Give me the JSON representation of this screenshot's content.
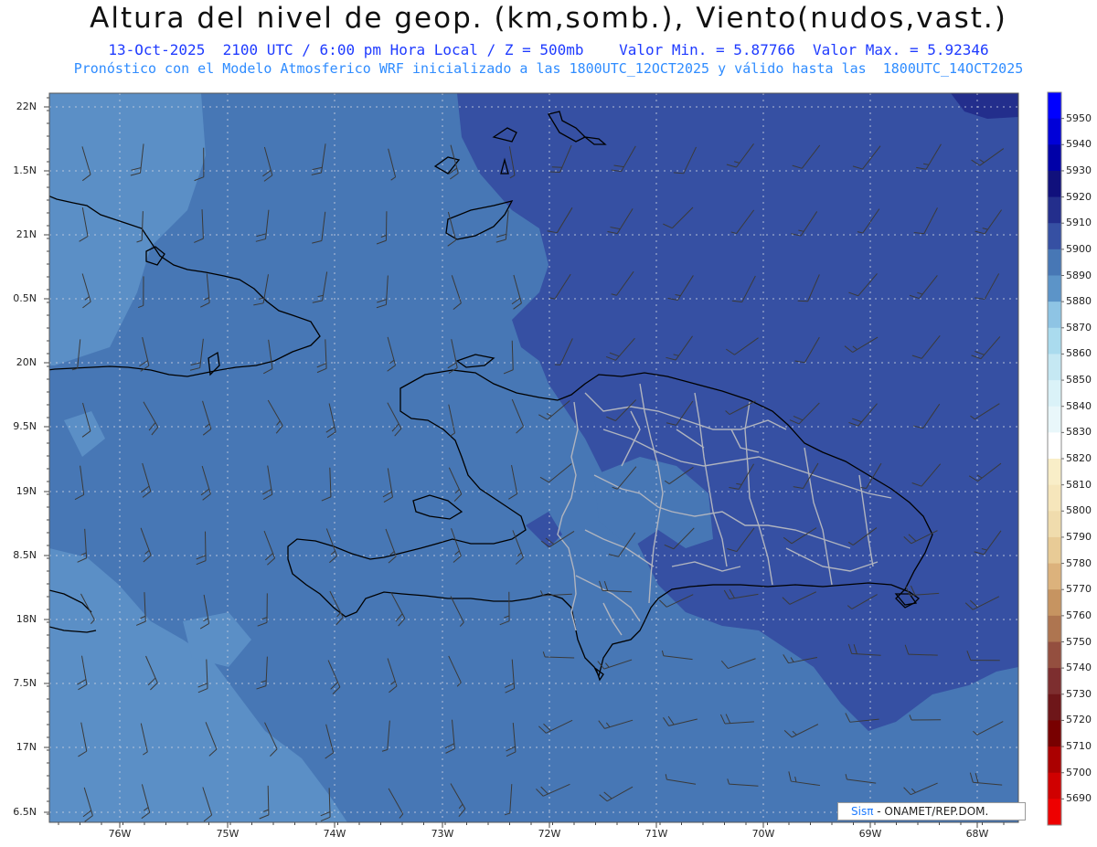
{
  "header": {
    "title": "Altura del nivel de geop. (km,somb.), Viento(nudos,vast.)",
    "subtitle": "13-Oct-2025  2100 UTC / 6:00 pm Hora Local / Z = 500mb    Valor Min. = 5.87766  Valor Max. = 5.92346",
    "subtitle2": "Pronóstico con el Modelo Atmosferico WRF inicializado a las 1800UTC_12OCT2025 y válido hasta las  1800UTC_14OCT2025"
  },
  "axes": {
    "lat_labels": [
      "22N",
      "1.5N",
      "21N",
      "0.5N",
      "20N",
      "9.5N",
      "19N",
      "8.5N",
      "18N",
      "7.5N",
      "17N",
      "6.5N"
    ],
    "lon_labels": [
      "76W",
      "75W",
      "74W",
      "73W",
      "72W",
      "71W",
      "70W",
      "69W",
      "68W"
    ]
  },
  "colorbar": {
    "labels": [
      "5950",
      "5940",
      "5930",
      "5920",
      "5910",
      "5900",
      "5890",
      "5880",
      "5870",
      "5860",
      "5850",
      "5840",
      "5830",
      "5820",
      "5810",
      "5800",
      "5790",
      "5780",
      "5770",
      "5760",
      "5750",
      "5740",
      "5730",
      "5720",
      "5710",
      "5700",
      "5690"
    ],
    "colors": [
      "#0000ff",
      "#0000d8",
      "#0000a8",
      "#10107c",
      "#232e8c",
      "#3650a3",
      "#4777b5",
      "#5c94c8",
      "#8ec4e4",
      "#aadbee",
      "#c5e8f3",
      "#daf2f8",
      "#e9f7fa",
      "#ffffff",
      "#f9eec8",
      "#f6e6bb",
      "#f0dcad",
      "#e8cb96",
      "#dcb27c",
      "#c69461",
      "#ae7550",
      "#944f3f",
      "#7d2e2f",
      "#6e1619",
      "#780000",
      "#aa0000",
      "#d00000",
      "#ee0000"
    ]
  },
  "legend_colors": {
    "low": "#4777b5",
    "mid": "#5b8fc6",
    "high": "#3650a3",
    "highest": "#232e8c"
  },
  "credit": {
    "sis": "Sisπ",
    "org": "- ONAMET/REP.DOM."
  }
}
